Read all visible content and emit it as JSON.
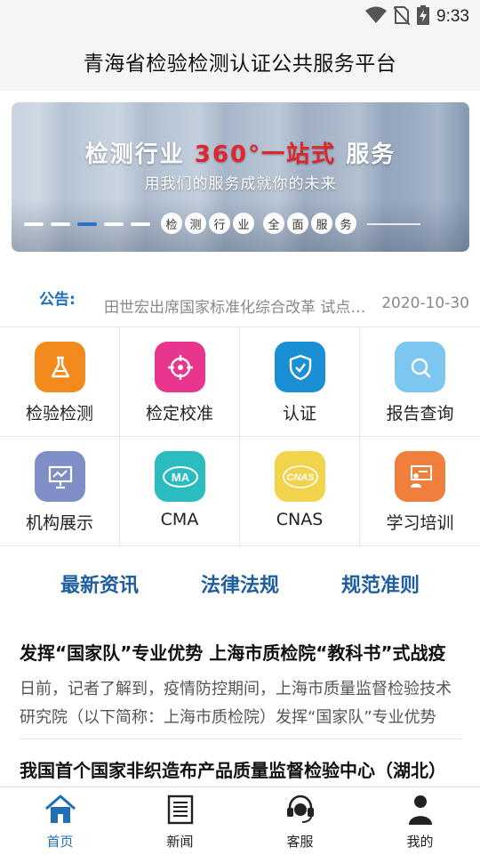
{
  "status_bar": {
    "time": "9:33",
    "icons": [
      "wifi-icon",
      "no-sim-icon",
      "battery-charging-icon"
    ]
  },
  "app": {
    "title": "青海省检验检测认证公共服务平台"
  },
  "banner": {
    "headline_prefix": "检测行业",
    "headline_accent": "360°一站式",
    "headline_suffix": "服务",
    "subtitle": "用我们的服务成就你的未来",
    "pills_group1": [
      "检",
      "测",
      "行",
      "业"
    ],
    "pills_group2": [
      "全",
      "面",
      "服",
      "务"
    ],
    "active_slide": 3,
    "slide_count": 5,
    "accent_color": "#e0262c"
  },
  "notice": {
    "label": "公告:",
    "text": "田世宏出席国家标准化综合改革 试点工作推进会",
    "date": "2020-10-30"
  },
  "services": [
    {
      "label": "检验检测",
      "icon": "flask-icon",
      "color": "#f28a1e"
    },
    {
      "label": "检定校准",
      "icon": "target-icon",
      "color": "#e8368f"
    },
    {
      "label": "认证",
      "icon": "shield-check-icon",
      "color": "#1a8fd6"
    },
    {
      "label": "报告查询",
      "icon": "search-icon",
      "color": "#7cc7ef"
    },
    {
      "label": "机构展示",
      "icon": "presentation-icon",
      "color": "#7f8ec7"
    },
    {
      "label": "CMA",
      "icon": "cma-logo-icon",
      "color": "#2bbcc0"
    },
    {
      "label": "CNAS",
      "icon": "cnas-logo-icon",
      "color": "#f2d34c"
    },
    {
      "label": "学习培训",
      "icon": "training-icon",
      "color": "#ef7f3c"
    }
  ],
  "tabs": [
    {
      "label": "最新资讯"
    },
    {
      "label": "法律法规"
    },
    {
      "label": "规范准则"
    }
  ],
  "news": [
    {
      "title": "发挥“国家队”专业优势 上海市质检院“教科书”式战疫",
      "summary": "日前，记者了解到，疫情防控期间，上海市质量监督检验技术研究院（以下简称：上海市质检院）发挥“国家队”专业优势"
    },
    {
      "title": "我国首个国家非织造布产品质量监督检验中心（湖北）",
      "summary": ""
    }
  ],
  "bottom_nav": [
    {
      "label": "首页",
      "icon": "home-icon",
      "active": true
    },
    {
      "label": "新闻",
      "icon": "news-icon",
      "active": false
    },
    {
      "label": "客服",
      "icon": "headset-icon",
      "active": false
    },
    {
      "label": "我的",
      "icon": "user-icon",
      "active": false
    }
  ],
  "colors": {
    "brand_blue": "#1f6fb8",
    "tab_blue": "#1f5fa0"
  }
}
